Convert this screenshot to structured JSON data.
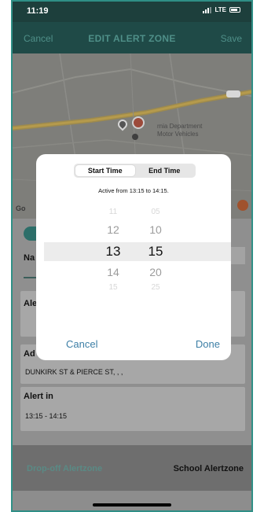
{
  "status_bar": {
    "time": "11:19",
    "network": "LTE"
  },
  "nav": {
    "cancel": "Cancel",
    "title": "EDIT ALERT ZONE",
    "save": "Save"
  },
  "map": {
    "place_label_line1": "rnia Department",
    "place_label_line2": "Motor Vehicles",
    "logo_text": "Go"
  },
  "form": {
    "name_label_fragment": "Na",
    "alert_label_fragment": "Ale",
    "address_label_fragment": "Ad",
    "address_value": "DUNKIRK ST & PIERCE ST, , ,",
    "alert_in_label": "Alert in",
    "alert_in_value": "13:15 - 14:15"
  },
  "tabs": {
    "left": "Drop-off Alertzone",
    "right": "School Alertzone"
  },
  "modal": {
    "segment_start": "Start Time",
    "segment_end": "End Time",
    "active_text": "Active from 13:15 to 14:15.",
    "hours": [
      "11",
      "12",
      "13",
      "14",
      "15"
    ],
    "minutes": [
      "05",
      "10",
      "15",
      "20",
      "25"
    ],
    "cancel": "Cancel",
    "done": "Done"
  },
  "colors": {
    "accent": "#2f8f86",
    "header_dark": "#1f4a47",
    "link_blue": "#3d7fa6"
  }
}
